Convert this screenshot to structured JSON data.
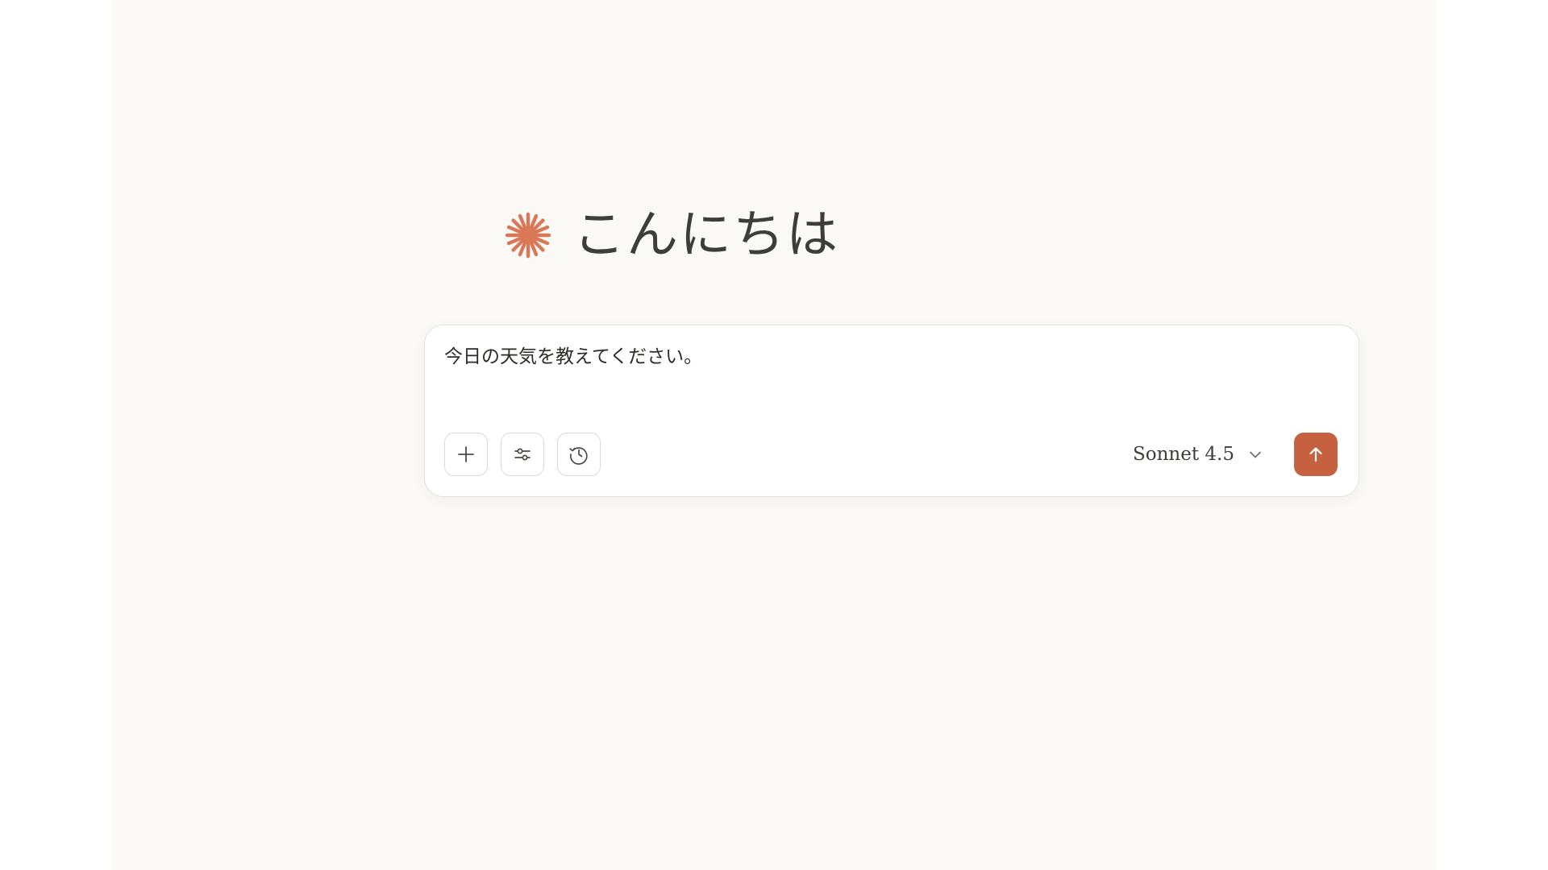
{
  "greeting": {
    "text": "こんにちは",
    "logo_icon": "asterisk-logo-icon",
    "logo_color": "#d97757"
  },
  "composer": {
    "input_value": "今日の天気を教えてください。",
    "buttons": {
      "add_icon": "plus-icon",
      "tools_icon": "sliders-icon",
      "history_icon": "clock-icon"
    },
    "model": {
      "selected": "Sonnet 4.5",
      "icon": "chevron-down-icon"
    },
    "send": {
      "icon": "arrow-up-icon",
      "color": "#c6613f"
    }
  }
}
